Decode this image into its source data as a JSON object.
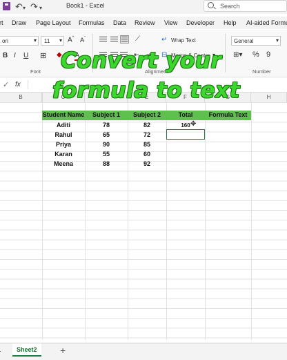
{
  "window": {
    "title": "Book1  -  Excel"
  },
  "search": {
    "label": "Search"
  },
  "menu": {
    "items": [
      "rt",
      "Draw",
      "Page Layout",
      "Formulas",
      "Data",
      "Review",
      "View",
      "Developer",
      "Help",
      "AI-aided Formu"
    ]
  },
  "ribbon": {
    "font_name": "ori",
    "font_size": "11",
    "wrap_text": "Wrap Text",
    "merge_center": "Merge & Center",
    "number_format": "General",
    "percent": "%",
    "comma": "9",
    "groups": {
      "font": "Font",
      "alignment": "Alignment",
      "number": "Number"
    }
  },
  "formula_bar": {
    "fx": "fx"
  },
  "overlay": {
    "line1": "Convert your",
    "line2": "formula to text"
  },
  "columns": [
    "B",
    "C",
    "D",
    "E",
    "F",
    "G",
    "H"
  ],
  "table": {
    "headers": [
      "Student Name",
      "Subject 1",
      "Subject 2",
      "Total",
      "Formula Text"
    ],
    "rows": [
      {
        "name": "Aditi",
        "s1": "78",
        "s2": "82",
        "total": "160"
      },
      {
        "name": "Rahul",
        "s1": "65",
        "s2": "72",
        "total": ""
      },
      {
        "name": "Priya",
        "s1": "90",
        "s2": "85",
        "total": ""
      },
      {
        "name": "Karan",
        "s1": "55",
        "s2": "60",
        "total": ""
      },
      {
        "name": "Meena",
        "s1": "88",
        "s2": "92",
        "total": ""
      }
    ]
  },
  "sheets": {
    "sheet1": "t1",
    "sheet2": "Sheet2",
    "add": "+"
  },
  "colors": {
    "header_fill": "#5fbf4f",
    "overlay_text": "#3dd62e",
    "selection": "#1e7b45"
  }
}
